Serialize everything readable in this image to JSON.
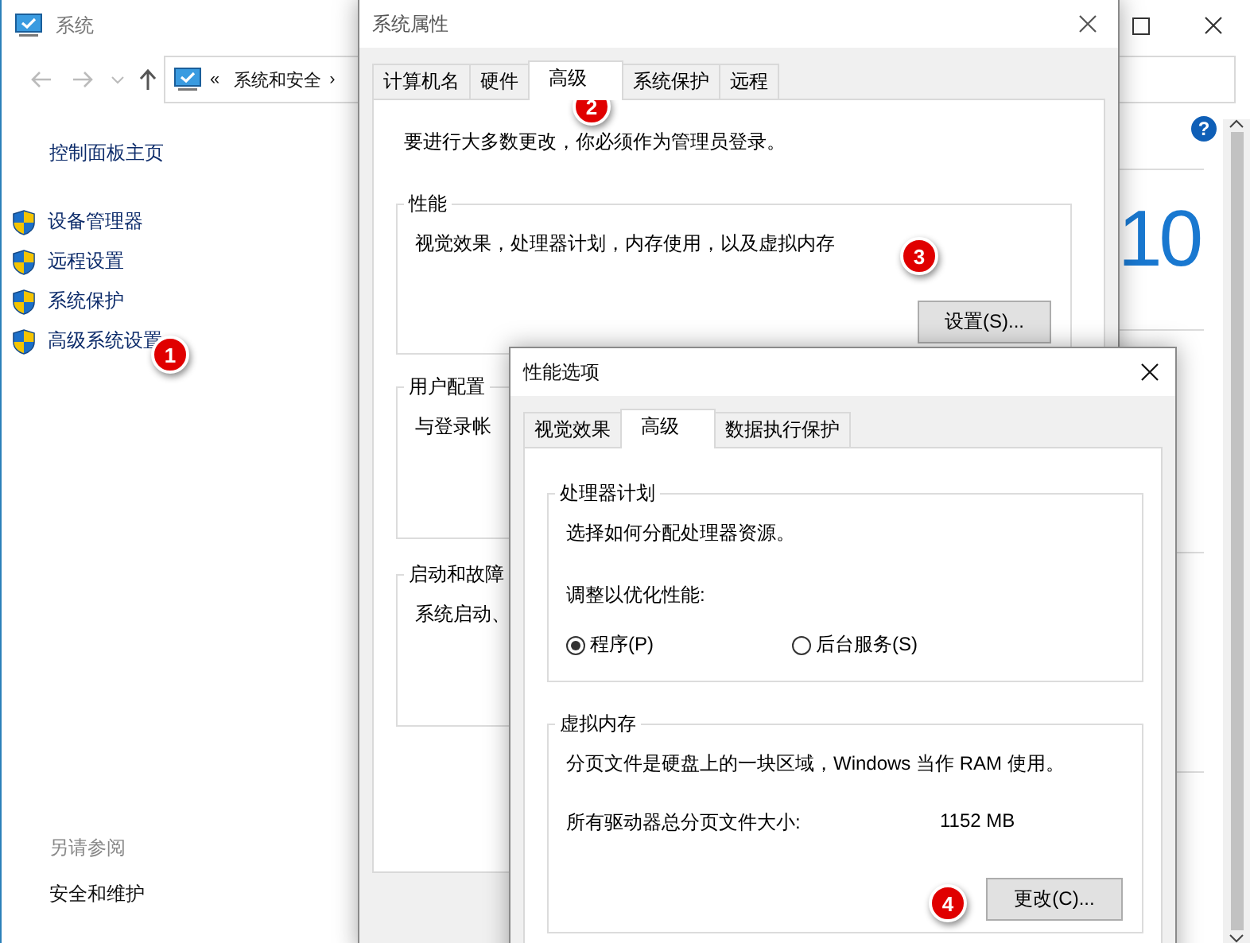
{
  "main_window": {
    "title": "系统",
    "breadcrumb": {
      "overflow": "«",
      "location": "系统和安全",
      "separator": "›"
    },
    "sidebar": {
      "home": "控制面板主页",
      "items": [
        {
          "label": "设备管理器"
        },
        {
          "label": "远程设置"
        },
        {
          "label": "系统保护"
        },
        {
          "label": "高级系统设置"
        }
      ],
      "see_also_title": "另请参阅",
      "see_also": [
        "安全和维护"
      ]
    },
    "help": "?",
    "logo_text": "10"
  },
  "system_properties": {
    "title": "系统属性",
    "tabs": [
      {
        "label": "计算机名",
        "selected": false
      },
      {
        "label": "硬件",
        "selected": false
      },
      {
        "label": "高级",
        "selected": true
      },
      {
        "label": "系统保护",
        "selected": false
      },
      {
        "label": "远程",
        "selected": false
      }
    ],
    "admin_note": "要进行大多数更改，你必须作为管理员登录。",
    "groups": [
      {
        "title": "性能",
        "text": "视觉效果，处理器计划，内存使用，以及虚拟内存",
        "button": "设置(S)..."
      },
      {
        "title": "用户配置",
        "text": "与登录帐"
      },
      {
        "title": "启动和故障",
        "text": "系统启动、"
      }
    ]
  },
  "performance_options": {
    "title": "性能选项",
    "tabs": [
      {
        "label": "视觉效果",
        "selected": false
      },
      {
        "label": "高级",
        "selected": true
      },
      {
        "label": "数据执行保护",
        "selected": false
      }
    ],
    "processor_group": {
      "title": "处理器计划",
      "text": "选择如何分配处理器资源。",
      "prompt": "调整以优化性能:",
      "options": [
        {
          "label": "程序(P)",
          "selected": true
        },
        {
          "label": "后台服务(S)",
          "selected": false
        }
      ]
    },
    "virtual_memory": {
      "title": "虚拟内存",
      "text": "分页文件是硬盘上的一块区域，Windows 当作 RAM 使用。",
      "size_label": "所有驱动器总分页文件大小:",
      "size_value": "1152 MB",
      "button": "更改(C)..."
    }
  },
  "step_markers": [
    {
      "label": "1"
    },
    {
      "label": "2"
    },
    {
      "label": "3"
    },
    {
      "label": "4"
    }
  ]
}
